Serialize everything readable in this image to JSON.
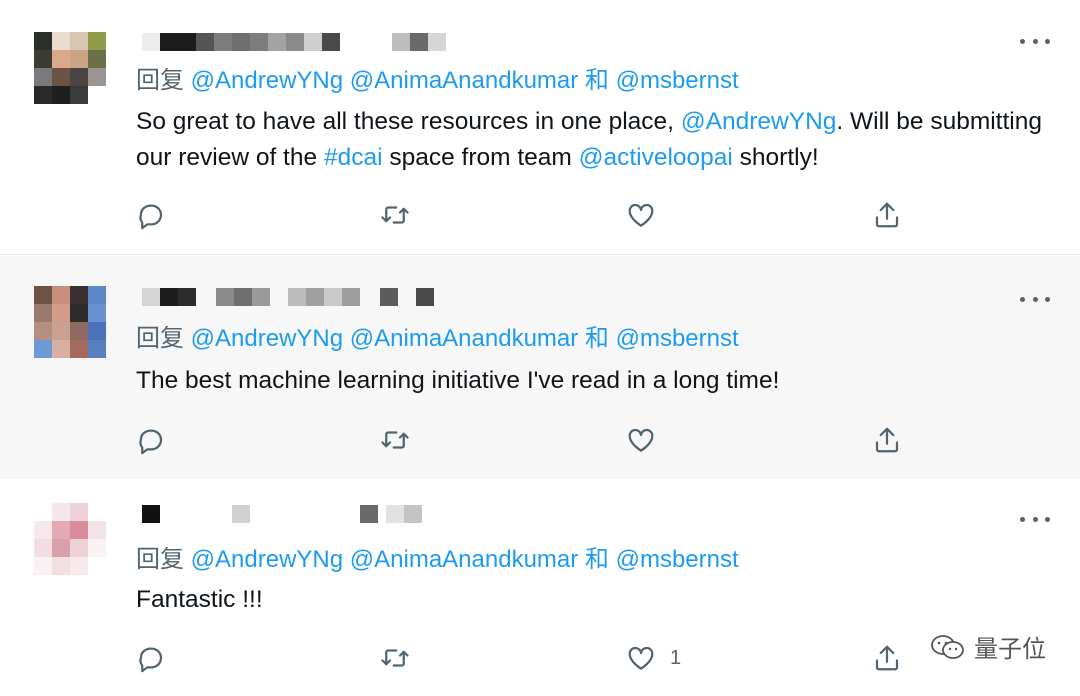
{
  "tweets": [
    {
      "reply_prefix": "回复",
      "mention_1": "@AndrewYNg",
      "mention_2": "@AnimaAnandkumar",
      "joiner": "和",
      "mention_3": "@msbernst",
      "text_parts": [
        "So great to have all these resources in one place, ",
        "@AndrewYNg",
        ". Will be submitting our review of the ",
        "#dcai",
        " space from team ",
        "@activeloopai",
        " shortly!"
      ],
      "like_count": ""
    },
    {
      "reply_prefix": "回复",
      "mention_1": "@AndrewYNg",
      "mention_2": "@AnimaAnandkumar",
      "joiner": "和",
      "mention_3": "@msbernst",
      "text": "The best machine learning initiative I've read in a long time!",
      "like_count": ""
    },
    {
      "reply_prefix": "回复",
      "mention_1": "@AndrewYNg",
      "mention_2": "@AnimaAnandkumar",
      "joiner": "和",
      "mention_3": "@msbernst",
      "text": "Fantastic !!!",
      "like_count": "1"
    }
  ],
  "watermark": {
    "label": "量子位"
  },
  "colors": {
    "link": "#1d9bf0",
    "muted": "#536471",
    "text": "#0f1419"
  },
  "icons": [
    "reply-icon",
    "retweet-icon",
    "like-icon",
    "share-icon",
    "more-icon",
    "wechat-icon"
  ]
}
